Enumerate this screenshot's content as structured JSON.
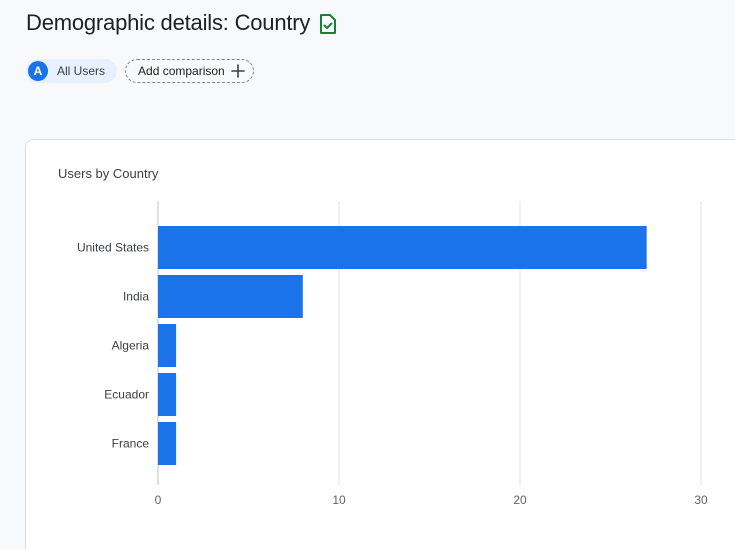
{
  "header": {
    "title": "Demographic details: Country",
    "verified_icon": "verified-document-icon"
  },
  "chips": {
    "segment_letter": "A",
    "segment_label": "All Users",
    "add_comparison_label": "Add comparison"
  },
  "colors": {
    "accent": "#1a73e8",
    "verified": "#188038",
    "bar": "#1a73e8",
    "grid": "#e0e0e0"
  },
  "card": {
    "title": "Users by Country"
  },
  "chart_data": {
    "type": "bar",
    "orientation": "horizontal",
    "title": "Users by Country",
    "categories": [
      "United States",
      "India",
      "Algeria",
      "Ecuador",
      "France"
    ],
    "values": [
      27,
      8,
      1,
      1,
      1
    ],
    "xlim": [
      0,
      30
    ],
    "xticks": [
      0,
      10,
      20,
      30
    ],
    "grid": true
  }
}
